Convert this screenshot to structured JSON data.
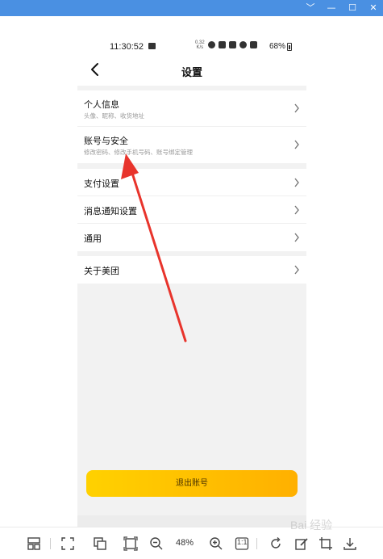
{
  "window": {
    "controls": [
      "﹀",
      "—",
      "☐",
      "✕"
    ]
  },
  "status_bar": {
    "time": "11:30:52",
    "net_speed": "0.32",
    "net_unit": "K/s",
    "battery": "68%"
  },
  "header": {
    "title": "设置"
  },
  "settings": {
    "group1": [
      {
        "title": "个人信息",
        "subtitle": "头像、昵称、收货地址"
      },
      {
        "title": "账号与安全",
        "subtitle": "修改密码、修改手机号码、账号绑定管理"
      }
    ],
    "group2": [
      {
        "title": "支付设置"
      },
      {
        "title": "消息通知设置"
      },
      {
        "title": "通用"
      }
    ],
    "group3": [
      {
        "title": "关于美团"
      }
    ]
  },
  "logout_label": "退出账号",
  "toolbar": {
    "zoom": "48%",
    "actual_size": "1:1"
  },
  "watermark": "Bai 经验",
  "colors": {
    "title_bar": "#4a90e2",
    "logout_start": "#ffd100",
    "logout_end": "#ffb000",
    "arrow": "#e8342c"
  }
}
